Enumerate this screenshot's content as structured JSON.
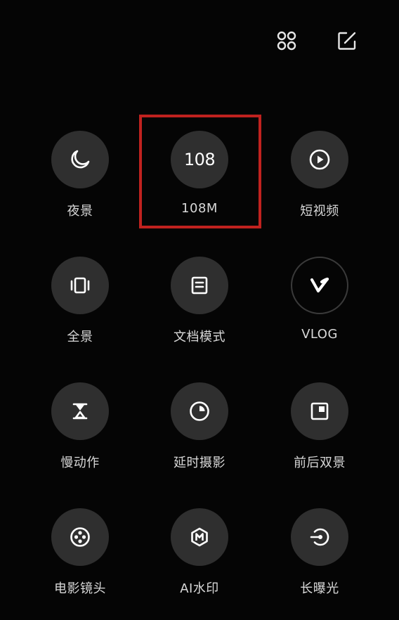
{
  "header": {
    "grid_icon": "grid-four-dots-icon",
    "edit_icon": "edit-square-icon"
  },
  "modes": [
    {
      "label": "夜景",
      "icon": "moon-icon"
    },
    {
      "label": "108M",
      "icon": "108-text-icon",
      "icon_text": "108"
    },
    {
      "label": "短视频",
      "icon": "play-circle-icon"
    },
    {
      "label": "全景",
      "icon": "panorama-icon"
    },
    {
      "label": "文档模式",
      "icon": "document-icon"
    },
    {
      "label": "VLOG",
      "icon": "vlog-v-icon"
    },
    {
      "label": "慢动作",
      "icon": "hourglass-icon"
    },
    {
      "label": "延时摄影",
      "icon": "timelapse-icon"
    },
    {
      "label": "前后双景",
      "icon": "dual-view-icon"
    },
    {
      "label": "电影镜头",
      "icon": "film-reel-icon"
    },
    {
      "label": "AI水印",
      "icon": "ai-watermark-icon"
    },
    {
      "label": "长曝光",
      "icon": "long-exposure-icon"
    }
  ],
  "colors": {
    "background": "#050505",
    "circle": "#2f2f2f",
    "highlight": "#c0221f",
    "text": "#d8d8d8"
  }
}
